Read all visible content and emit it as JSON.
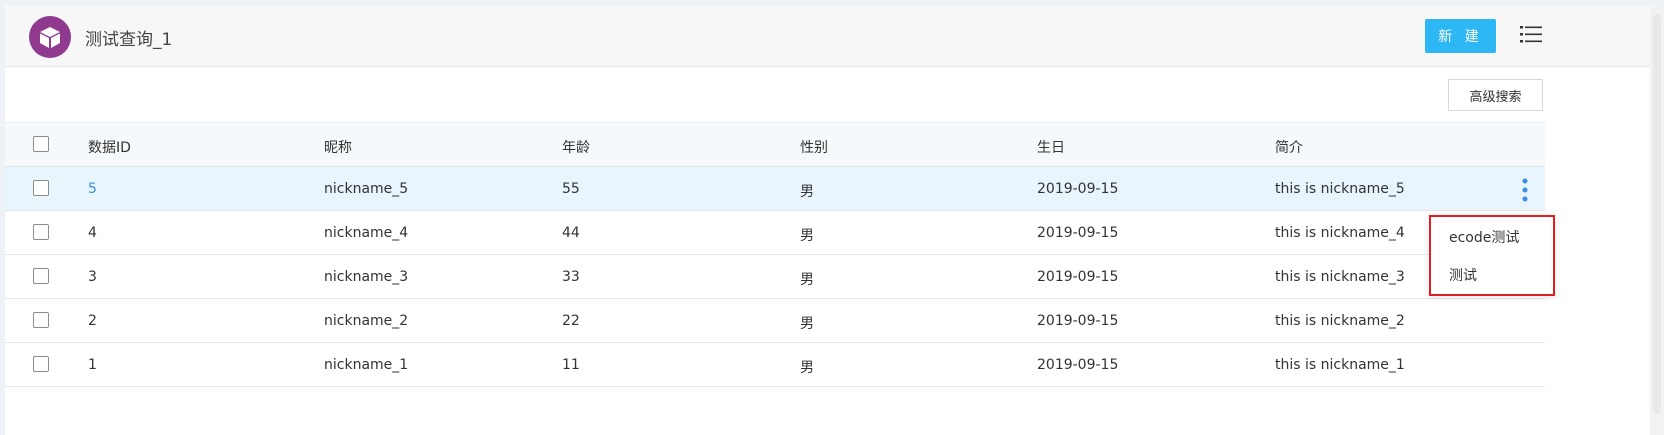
{
  "header": {
    "title": "测试查询_1",
    "new_label": "新 建"
  },
  "toolbar": {
    "advanced_search_label": "高级搜索"
  },
  "table": {
    "columns": [
      "数据ID",
      "昵称",
      "年龄",
      "性别",
      "生日",
      "简介"
    ],
    "rows": [
      {
        "id": "5",
        "nickname": "nickname_5",
        "age": "55",
        "sex": "男",
        "birthday": "2019-09-15",
        "intro": "this is nickname_5"
      },
      {
        "id": "4",
        "nickname": "nickname_4",
        "age": "44",
        "sex": "男",
        "birthday": "2019-09-15",
        "intro": "this is nickname_4"
      },
      {
        "id": "3",
        "nickname": "nickname_3",
        "age": "33",
        "sex": "男",
        "birthday": "2019-09-15",
        "intro": "this is nickname_3"
      },
      {
        "id": "2",
        "nickname": "nickname_2",
        "age": "22",
        "sex": "男",
        "birthday": "2019-09-15",
        "intro": "this is nickname_2"
      },
      {
        "id": "1",
        "nickname": "nickname_1",
        "age": "11",
        "sex": "男",
        "birthday": "2019-09-15",
        "intro": "this is nickname_1"
      }
    ]
  },
  "row_menu": {
    "items": [
      "ecode测试",
      "测试"
    ]
  },
  "icons": {
    "logo": "cube-icon",
    "menu": "list-icon",
    "row_actions": "kebab-icon"
  },
  "colors": {
    "accent": "#2db7f5",
    "logo_bg": "#8f3a8f",
    "link": "#3a8ee6",
    "hover_row": "#e8f5fd",
    "highlight_border": "#e02020"
  }
}
